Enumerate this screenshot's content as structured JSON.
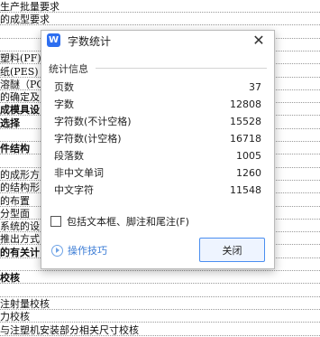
{
  "document": {
    "lines": [
      {
        "text": "生产批量要求",
        "bold": false
      },
      {
        "text": "的成型要求",
        "bold": false
      },
      {
        "text": "",
        "bold": false
      },
      {
        "text": "",
        "bold": false
      },
      {
        "text": "塑料(PF)",
        "bold": false
      },
      {
        "text": "纸(PES)",
        "bold": false
      },
      {
        "text": "溶醚（PC",
        "bold": false
      },
      {
        "text": "的确定及",
        "bold": false
      },
      {
        "text": "成模具设",
        "bold": true
      },
      {
        "text": "选择",
        "bold": true
      },
      {
        "text": "",
        "bold": false
      },
      {
        "text": "件结构",
        "bold": true
      },
      {
        "text": "",
        "bold": false
      },
      {
        "text": "的成形方",
        "bold": false
      },
      {
        "text": "的结构形",
        "bold": false
      },
      {
        "text": "的布置",
        "bold": false
      },
      {
        "text": "分型面",
        "bold": false
      },
      {
        "text": "系统的设",
        "bold": false
      },
      {
        "text": "推出方式",
        "bold": false
      },
      {
        "text": "的有关计",
        "bold": true
      },
      {
        "text": "",
        "bold": false
      },
      {
        "text": "校核",
        "bold": true
      },
      {
        "text": "",
        "bold": false
      },
      {
        "text": "注射量校核",
        "bold": false
      },
      {
        "text": "力校核",
        "bold": false
      },
      {
        "text": "与注塑机安装部分相关尺寸校核",
        "bold": false
      }
    ]
  },
  "dialog": {
    "app_icon_letter": "W",
    "title": "字数统计",
    "close_icon_glyph": "✕",
    "section_header": "统计信息",
    "stats": [
      {
        "label": "页数",
        "value": "37"
      },
      {
        "label": "字数",
        "value": "12808"
      },
      {
        "label": "字符数(不计空格)",
        "value": "15528"
      },
      {
        "label": "字符数(计空格)",
        "value": "16718"
      },
      {
        "label": "段落数",
        "value": "1005"
      },
      {
        "label": "非中文单词",
        "value": "1260"
      },
      {
        "label": "中文字符",
        "value": "11548"
      }
    ],
    "checkbox_label": "包括文本框、脚注和尾注(F)",
    "checkbox_checked": false,
    "tips_label": "操作技巧",
    "close_button_label": "关闭"
  }
}
